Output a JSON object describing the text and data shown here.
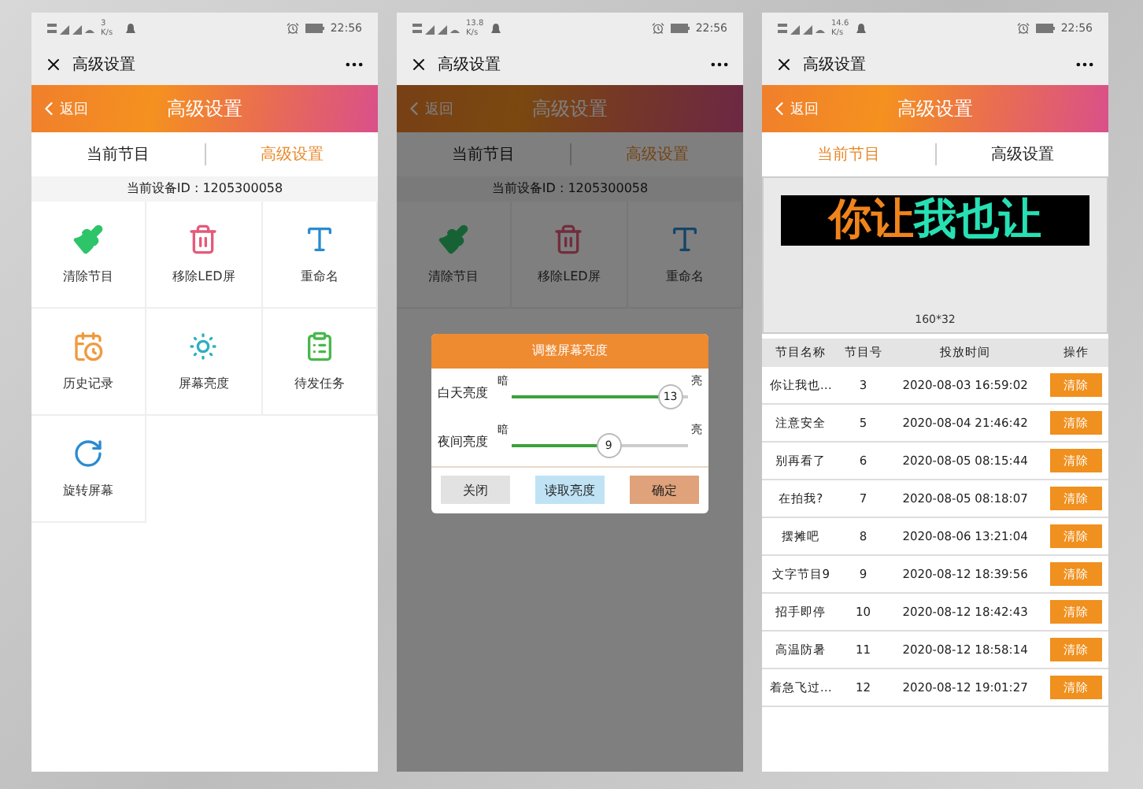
{
  "phones": [
    {
      "kind": "grid",
      "status_bar": {
        "speed": "3 K/s",
        "time": "22:56"
      },
      "title_bar": {
        "title": "高级设置"
      },
      "header": {
        "back": "返回",
        "title": "高级设置"
      },
      "tabs": [
        {
          "label": "当前节目",
          "selected": false
        },
        {
          "label": "高级设置",
          "selected": true
        }
      ],
      "device_id": "当前设备ID : 1205300058",
      "grid": [
        {
          "label": "清除节目"
        },
        {
          "label": "移除LED屏"
        },
        {
          "label": "重命名"
        },
        {
          "label": "历史记录"
        },
        {
          "label": "屏幕亮度"
        },
        {
          "label": "待发任务"
        },
        {
          "label": "旋转屏幕"
        }
      ]
    },
    {
      "kind": "dialog",
      "status_bar": {
        "speed": "13.8 K/s",
        "time": "22:56"
      },
      "title_bar": {
        "title": "高级设置"
      },
      "header": {
        "back": "返回",
        "title": "高级设置"
      },
      "tabs": [
        {
          "label": "当前节目",
          "selected": false
        },
        {
          "label": "高级设置",
          "selected": true
        }
      ],
      "device_id": "当前设备ID : 1205300058",
      "grid": [
        {
          "label": "清除节目"
        },
        {
          "label": "移除LED屏"
        },
        {
          "label": "重命名"
        }
      ],
      "dialog": {
        "title": "调整屏幕亮度",
        "sliders": [
          {
            "label": "白天亮度",
            "dark": "暗",
            "bright": "亮",
            "level": 0.9,
            "reading": "13"
          },
          {
            "label": "夜间亮度",
            "dark": "暗",
            "bright": "亮",
            "level": 0.55,
            "reading": "9"
          }
        ],
        "buttons": [
          {
            "label": "关闭",
            "kind": "close"
          },
          {
            "label": "读取亮度",
            "kind": "read"
          },
          {
            "label": "确定",
            "kind": "confirm"
          }
        ]
      }
    },
    {
      "kind": "table",
      "status_bar": {
        "speed": "14.6 K/s",
        "time": "22:56"
      },
      "title_bar": {
        "title": "高级设置"
      },
      "header": {
        "back": "返回",
        "title": "高级设置"
      },
      "tabs": [
        {
          "label": "当前节目",
          "selected": true
        },
        {
          "label": "高级设置",
          "selected": false
        }
      ],
      "preview": {
        "text_left": "你让",
        "text_right": "我也让",
        "size": "160*32"
      },
      "table": {
        "columns": [
          "节目名称",
          "节目号",
          "投放时间",
          "操作"
        ],
        "rows": [
          [
            "你让我也…",
            "3",
            "2020-08-03 16:59:02",
            "清除"
          ],
          [
            "注意安全",
            "5",
            "2020-08-04 21:46:42",
            "清除"
          ],
          [
            "别再看了",
            "6",
            "2020-08-05 08:15:44",
            "清除"
          ],
          [
            "在拍我?",
            "7",
            "2020-08-05 08:18:07",
            "清除"
          ],
          [
            "摆摊吧",
            "8",
            "2020-08-06 13:21:04",
            "清除"
          ],
          [
            "文字节目9",
            "9",
            "2020-08-12 18:39:56",
            "清除"
          ],
          [
            "招手即停",
            "10",
            "2020-08-12 18:42:43",
            "清除"
          ],
          [
            "高温防暑",
            "11",
            "2020-08-12 18:58:14",
            "清除"
          ],
          [
            "着急飞过…",
            "12",
            "2020-08-12 19:01:27",
            "清除"
          ]
        ]
      }
    }
  ]
}
